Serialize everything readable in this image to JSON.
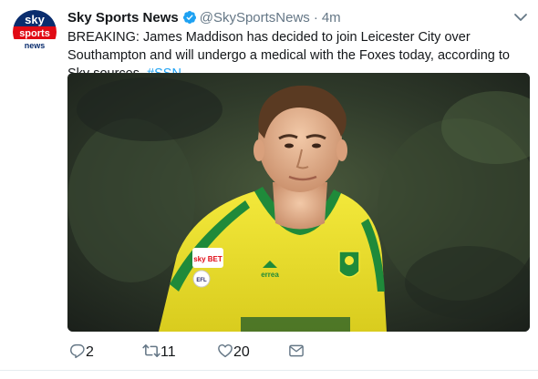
{
  "tweet": {
    "author": {
      "name": "Sky Sports News",
      "handle": "@SkySportsNews",
      "verified": true,
      "avatar_logo": {
        "line1": "sky",
        "line2": "sports",
        "line3": "news"
      }
    },
    "separator": "·",
    "time": "4m",
    "text_before": "BREAKING: James Maddison has decided to join Leicester City over Southampton and will undergo a medical with the Foxes today, according to Sky sources. ",
    "hashtag": "#SSN",
    "media": {
      "kit_badge_text": "sky BET",
      "kit_efl_text": "EFL",
      "kit_sponsor_text": "errea"
    },
    "actions": {
      "reply_count": "2",
      "retweet_count": "11",
      "like_count": "20"
    },
    "icons": {
      "verified": "verified-badge-icon",
      "caret": "chevron-down-icon",
      "reply": "reply-icon",
      "retweet": "retweet-icon",
      "like": "heart-icon",
      "dm": "envelope-icon"
    },
    "colors": {
      "accent": "#1da1f2",
      "muted": "#657786",
      "text": "#14171a",
      "sky_red": "#e10a14",
      "sky_blue": "#0a2d6e"
    }
  }
}
